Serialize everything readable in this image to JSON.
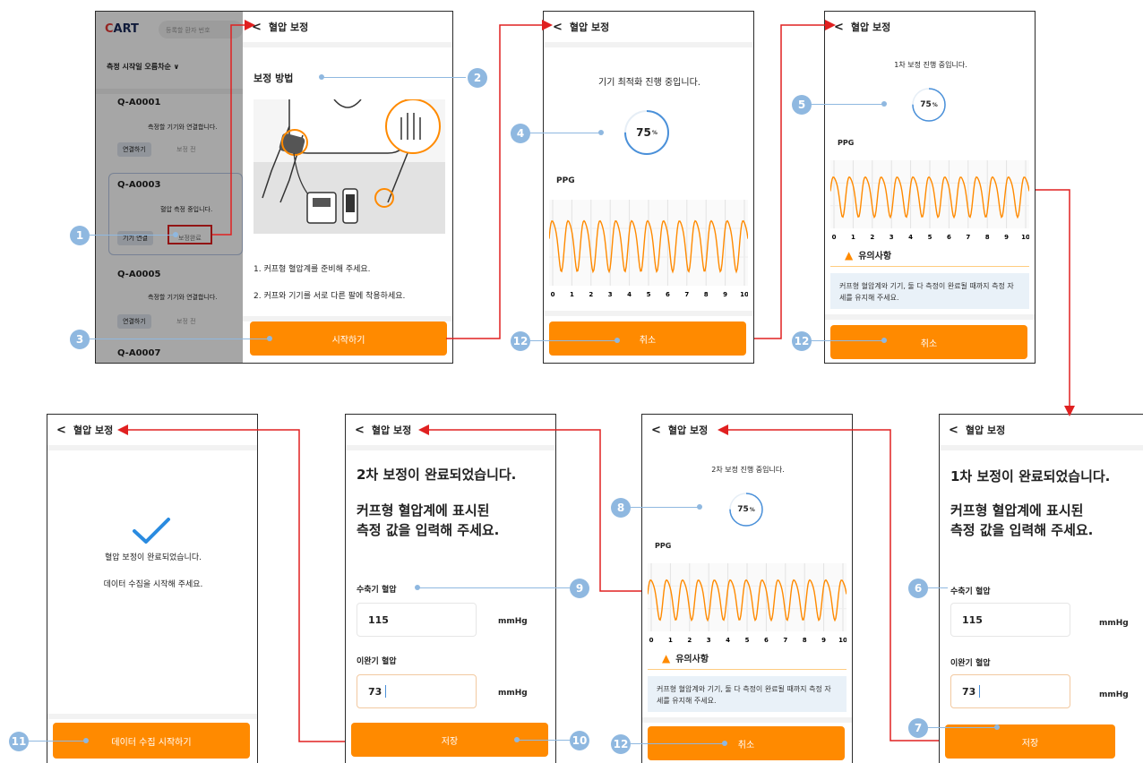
{
  "common": {
    "header_title": "혈압 보정",
    "back_glyph": "<",
    "cancel_label": "취소",
    "save_label": "저장",
    "ppg_label": "PPG",
    "notice_title": "유의사항",
    "notice_text": "커프형 혈압계와 기기, 둘 다 측정이 완료될 때까지 측정 자세를 유지해 주세요.",
    "percent_value": "75",
    "percent_unit": "%",
    "x_ticks": [
      "0",
      "1",
      "2",
      "3",
      "4",
      "5",
      "6",
      "7",
      "8",
      "9",
      "10"
    ],
    "systolic_label": "수축기 혈압",
    "diastolic_label": "이완기 혈압",
    "unit": "mmHg",
    "systolic_value": "115",
    "diastolic_value": "73",
    "input_prompt": "커프형 혈압계에 표시된 측정 값을 입력해 주세요."
  },
  "list_screen": {
    "logo_c": "C",
    "logo_rest": "ART",
    "search_placeholder": "등록할 환자 번호",
    "sort_label": "측정 시작일 오름차순",
    "items": [
      {
        "id": "Q-A0001",
        "msg": "측정할 기기와 연결합니다.",
        "btn1": "연결하기",
        "btn2": "보정 전"
      },
      {
        "id": "Q-A0003",
        "msg": "혈압 측정 중입니다.",
        "btn1": "기기 연결",
        "btn2": "보정완료"
      },
      {
        "id": "Q-A0005",
        "msg": "측정할 기기와 연결합니다.",
        "btn1": "연결하기",
        "btn2": "보정 전"
      },
      {
        "id": "Q-A0007",
        "msg": "",
        "btn1": "",
        "btn2": ""
      }
    ]
  },
  "screen1": {
    "section_title": "보정 방법",
    "step1": "1. 커프형 혈압계를 준비해 주세요.",
    "step2": "2. 커프와 기기를 서로 다른 팔에 착용하세요.",
    "start_label": "시작하기"
  },
  "screen2": {
    "status": "기기 최적화 진행 중입니다."
  },
  "screen3": {
    "status": "1차 보정 진행 중입니다."
  },
  "screen4": {
    "done": "1차 보정이 완료되었습니다."
  },
  "screen5": {
    "status": "2차 보정 진행 중입니다."
  },
  "screen6": {
    "done": "2차 보정이 완료되었습니다."
  },
  "screen7": {
    "line1": "혈압 보정이 완료되었습니다.",
    "line2": "데이터 수집을 시작해 주세요.",
    "collect_label": "데이터 수집 시작하기"
  },
  "callouts": [
    "1",
    "2",
    "3",
    "4",
    "5",
    "6",
    "7",
    "8",
    "9",
    "10",
    "11",
    "12",
    "12",
    "12"
  ],
  "colors": {
    "accent": "#ff8a00",
    "callout": "#8fb8e0",
    "flow_arrow": "#e02020",
    "check": "#2a8be0"
  }
}
